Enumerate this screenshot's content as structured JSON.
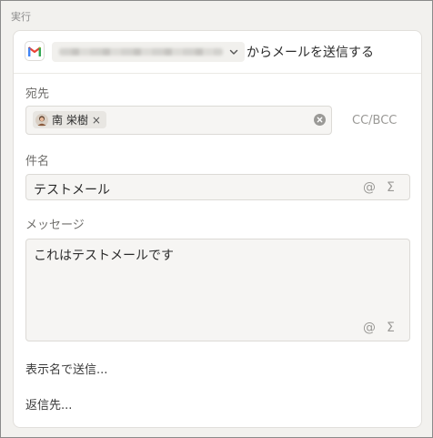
{
  "section": {
    "label": "実行"
  },
  "header": {
    "service_icon": "gmail-icon",
    "account_placeholder": "",
    "action_label": "からメールを送信する"
  },
  "to": {
    "label": "宛先",
    "recipients": [
      {
        "name": "南 栄樹"
      }
    ],
    "cc_bcc_label": "CC/BCC"
  },
  "subject": {
    "label": "件名",
    "value": "テストメール"
  },
  "message": {
    "label": "メッセージ",
    "value": "これはテストメールです"
  },
  "icons": {
    "mention": "@",
    "formula": "Σ",
    "chip_remove": "×"
  },
  "links": {
    "display_name": "表示名で送信...",
    "reply_to": "返信先..."
  },
  "colors": {
    "gmail_red": "#ea4335",
    "gmail_blue": "#4285f4",
    "gmail_green": "#34a853",
    "gmail_yellow": "#fbbc04"
  }
}
